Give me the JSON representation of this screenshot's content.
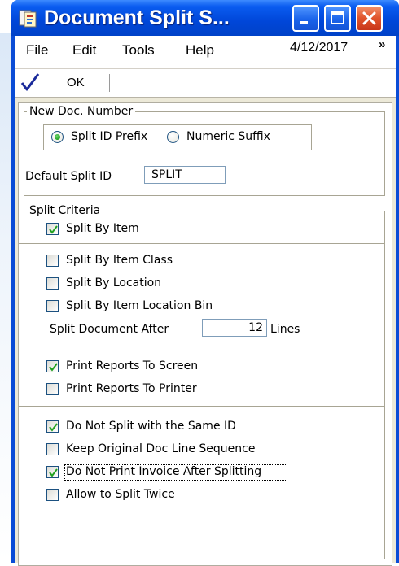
{
  "window": {
    "title": "Document Split S...",
    "icon": "document-split-app-icon"
  },
  "menu": {
    "items": [
      "File",
      "Edit",
      "Tools",
      "Help"
    ],
    "user_date": "4/12/2017",
    "overflow_glyph": "»"
  },
  "toolbar": {
    "ok_label": "OK"
  },
  "new_doc_number": {
    "legend": "New Doc. Number",
    "options": [
      {
        "label": "Split ID Prefix",
        "selected": true
      },
      {
        "label": "Numeric Suffix",
        "selected": false
      }
    ],
    "default_split_id_label": "Default Split ID",
    "default_split_id_value": "SPLIT"
  },
  "split_criteria": {
    "legend": "Split Criteria",
    "split_by_item": {
      "label": "Split By Item",
      "checked": true
    },
    "item_options": [
      {
        "label": "Split By Item Class",
        "checked": false
      },
      {
        "label": "Split By Location",
        "checked": false
      },
      {
        "label": "Split By Item Location Bin",
        "checked": false
      }
    ],
    "split_after_label": "Split Document After",
    "split_after_value": "12",
    "split_after_unit": "Lines",
    "report_options": [
      {
        "label": "Print Reports To Screen",
        "checked": true
      },
      {
        "label": "Print Reports To Printer",
        "checked": false
      }
    ],
    "other_options": [
      {
        "label": "Do Not Split with the Same ID",
        "checked": true
      },
      {
        "label": "Keep Original Doc Line Sequence",
        "checked": false
      },
      {
        "label": "Do Not Print Invoice After Splitting",
        "checked": true
      },
      {
        "label": "Allow to Split Twice",
        "checked": false
      }
    ]
  },
  "colors": {
    "titlebar": "#0046d8",
    "close_button": "#e0532b",
    "check_mark": "#21a121",
    "window_face": "#ece9d8"
  }
}
